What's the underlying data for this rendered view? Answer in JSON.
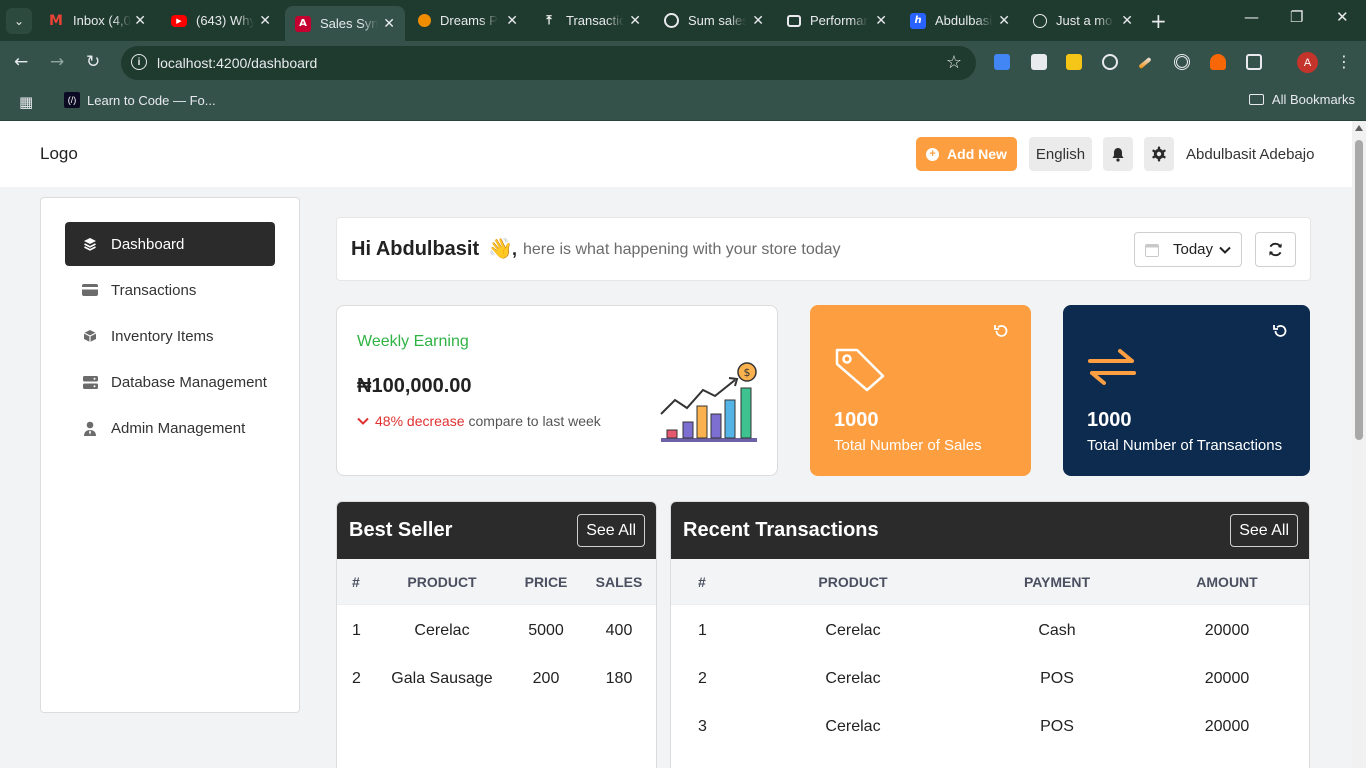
{
  "browser": {
    "tabs": [
      {
        "title": "Inbox (4,0",
        "favicon": "gmail-icon"
      },
      {
        "title": "(643) Why",
        "favicon": "youtube-icon"
      },
      {
        "title": "Sales Sync",
        "favicon": "angular-icon",
        "active": true
      },
      {
        "title": "Dreams P",
        "favicon": "dreams-icon"
      },
      {
        "title": "Transactio",
        "favicon": "upload-icon"
      },
      {
        "title": "Sum sales",
        "favicon": "chatgpt-icon"
      },
      {
        "title": "Performan",
        "favicon": "slides-icon"
      },
      {
        "title": "Abdulbasi",
        "favicon": "hashnode-icon"
      },
      {
        "title": "Just a mo",
        "favicon": "globe-icon"
      }
    ],
    "url": "localhost:4200/dashboard",
    "bookmark_label": "Learn to Code — Fo...",
    "all_bookmarks": "All Bookmarks",
    "profile_initial": "A"
  },
  "header": {
    "logo": "Logo",
    "add_new": "Add New",
    "language": "English",
    "user_name": "Abdulbasit Adebajo",
    "accent": "#fd9f41"
  },
  "sidebar": {
    "items": [
      {
        "label": "Dashboard",
        "icon": "layers-icon",
        "active": true
      },
      {
        "label": "Transactions",
        "icon": "credit-card-icon"
      },
      {
        "label": "Inventory Items",
        "icon": "box-icon"
      },
      {
        "label": "Database Management",
        "icon": "server-icon"
      },
      {
        "label": "Admin Management",
        "icon": "user-tie-icon"
      }
    ]
  },
  "greeting": {
    "hi": "Hi Abdulbasit",
    "emoji": "👋",
    "comma": ",",
    "message": "here is what happening with your store today",
    "period": "Today"
  },
  "weekly": {
    "title": "Weekly Earning",
    "value": "₦100,000.00",
    "change": "48% decrease",
    "compare": "compare to last week"
  },
  "stats": [
    {
      "value": "1000",
      "label": "Total Number of Sales",
      "color": "#fd9f41",
      "icon": "tag-icon"
    },
    {
      "value": "1000",
      "label": "Total Number of Transactions",
      "color": "#0d2b4e",
      "icon": "swap-arrows-icon"
    }
  ],
  "best_seller": {
    "title": "Best Seller",
    "see_all": "See All",
    "columns": [
      "#",
      "PRODUCT",
      "PRICE",
      "SALES"
    ],
    "rows": [
      [
        "1",
        "Cerelac",
        "5000",
        "400"
      ],
      [
        "2",
        "Gala Sausage",
        "200",
        "180"
      ]
    ]
  },
  "recent": {
    "title": "Recent Transactions",
    "see_all": "See All",
    "columns": [
      "#",
      "PRODUCT",
      "PAYMENT",
      "AMOUNT"
    ],
    "rows": [
      [
        "1",
        "Cerelac",
        "Cash",
        "20000"
      ],
      [
        "2",
        "Cerelac",
        "POS",
        "20000"
      ],
      [
        "3",
        "Cerelac",
        "POS",
        "20000"
      ]
    ]
  }
}
